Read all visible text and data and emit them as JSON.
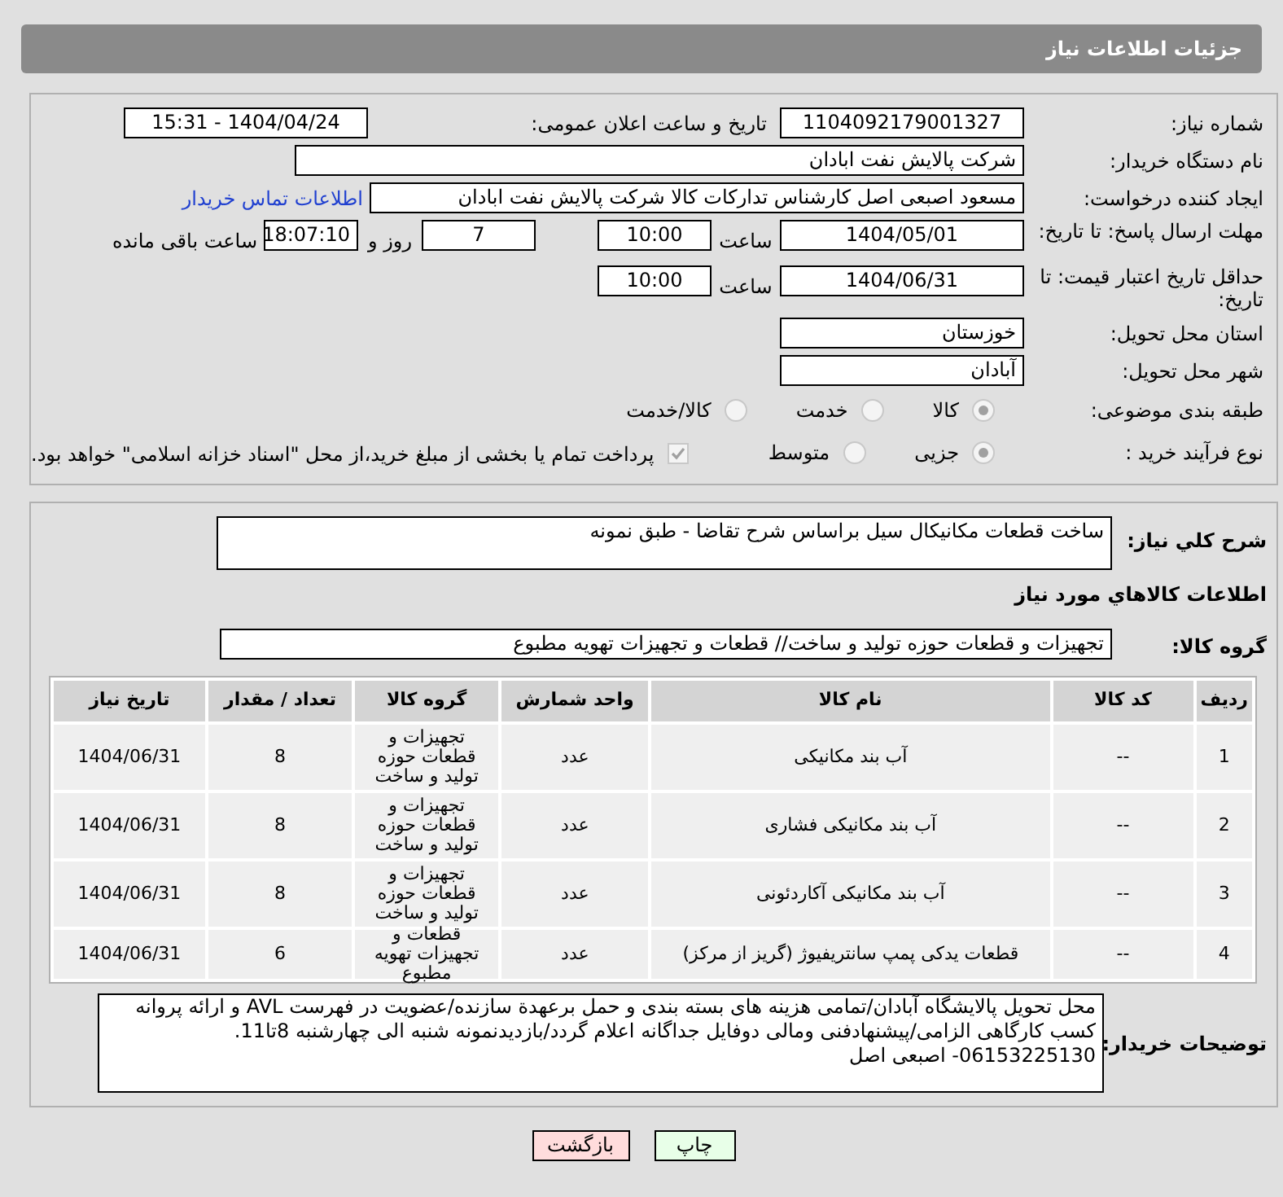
{
  "header": {
    "title": "جزئیات اطلاعات نیاز"
  },
  "need_number": {
    "label": "شماره نیاز:",
    "value": "1104092179001327"
  },
  "announce": {
    "label": "تاریخ و ساعت اعلان عمومی:",
    "value": "1404/04/24 - 15:31"
  },
  "buyer_org": {
    "label": "نام دستگاه خریدار:",
    "value": "شرکت پالایش نفت ابادان"
  },
  "requester": {
    "label": "ایجاد کننده درخواست:",
    "value": "مسعود اصبعی اصل کارشناس تدارکات کالا  شرکت پالایش نفت ابادان",
    "link": "اطلاعات تماس خریدار"
  },
  "reply_deadline": {
    "label": "مهلت ارسال پاسخ: تا تاریخ:",
    "date": "1404/05/01",
    "time_label": "ساعت",
    "time": "10:00",
    "days": "7",
    "days_label": "روز و",
    "remaining": "18:07:10",
    "remaining_label": "ساعت باقی مانده"
  },
  "price_validity": {
    "label": "حداقل تاریخ اعتبار قیمت: تا تاریخ:",
    "date": "1404/06/31",
    "time_label": "ساعت",
    "time": "10:00"
  },
  "province": {
    "label": "استان محل تحویل:",
    "value": "خوزستان"
  },
  "city": {
    "label": "شهر محل تحویل:",
    "value": "آبادان"
  },
  "category": {
    "label": "طبقه بندی موضوعی:",
    "options": [
      {
        "label": "کالا",
        "selected": true
      },
      {
        "label": "خدمت",
        "selected": false
      },
      {
        "label": "کالا/خدمت",
        "selected": false
      }
    ]
  },
  "process": {
    "label": "نوع فرآیند خرید :",
    "options": [
      {
        "label": "جزیی",
        "selected": true
      },
      {
        "label": "متوسط",
        "selected": false
      }
    ],
    "payment_note": {
      "checked": true,
      "text": "پرداخت تمام یا بخشی از مبلغ خرید،از محل \"اسناد خزانه اسلامی\" خواهد بود."
    }
  },
  "description": {
    "label": "شرح کلي نیاز:",
    "value": "ساخت قطعات مکانیکال سیل براساس شرح تقاضا - طبق نمونه"
  },
  "goods_section": {
    "title": "اطلاعات کالاهاي مورد نیاز"
  },
  "goods_group": {
    "label": "گروه کالا:",
    "value": "تجهیزات و قطعات حوزه تولید و ساخت//  قطعات و تجهیزات تهویه مطبوع"
  },
  "table": {
    "columns": [
      "ردیف",
      "کد کالا",
      "نام کالا",
      "واحد شمارش",
      "گروه کالا",
      "تعداد / مقدار",
      "تاریخ نیاز"
    ],
    "rows": [
      [
        "1",
        "--",
        "آب بند مکانیکی",
        "عدد",
        "تجهیزات و قطعات حوزه تولید و ساخت",
        "8",
        "1404/06/31"
      ],
      [
        "2",
        "--",
        "آب بند مکانیکی فشاری",
        "عدد",
        "تجهیزات و قطعات حوزه تولید و ساخت",
        "8",
        "1404/06/31"
      ],
      [
        "3",
        "--",
        "آب بند مکانیکی آکاردئونی",
        "عدد",
        "تجهیزات و قطعات حوزه تولید و ساخت",
        "8",
        "1404/06/31"
      ],
      [
        "4",
        "--",
        "قطعات یدکی پمپ سانتریفیوژ (گریز از مرکز)",
        "عدد",
        "قطعات و تجهیزات تهویه مطبوع",
        "6",
        "1404/06/31"
      ]
    ]
  },
  "buyer_notes": {
    "label": "توضیحات خریدار:",
    "value": "محل تحویل پالایشگاه آبادان/تمامی هزینه های بسته بندی و حمل برعهدة سازنده/عضویت در فهرست AVL و ارائه پروانه کسب کارگاهی الزامی/پیشنهادفنی ومالی دوفایل جداگانه اعلام گردد/بازدیدنمونه شنبه الی چهارشنبه 8تا11. 06153225130- اصبعی اصل"
  },
  "buttons": [
    {
      "label": "چاپ",
      "kind": "print"
    },
    {
      "label": "بازگشت",
      "kind": "back"
    }
  ]
}
